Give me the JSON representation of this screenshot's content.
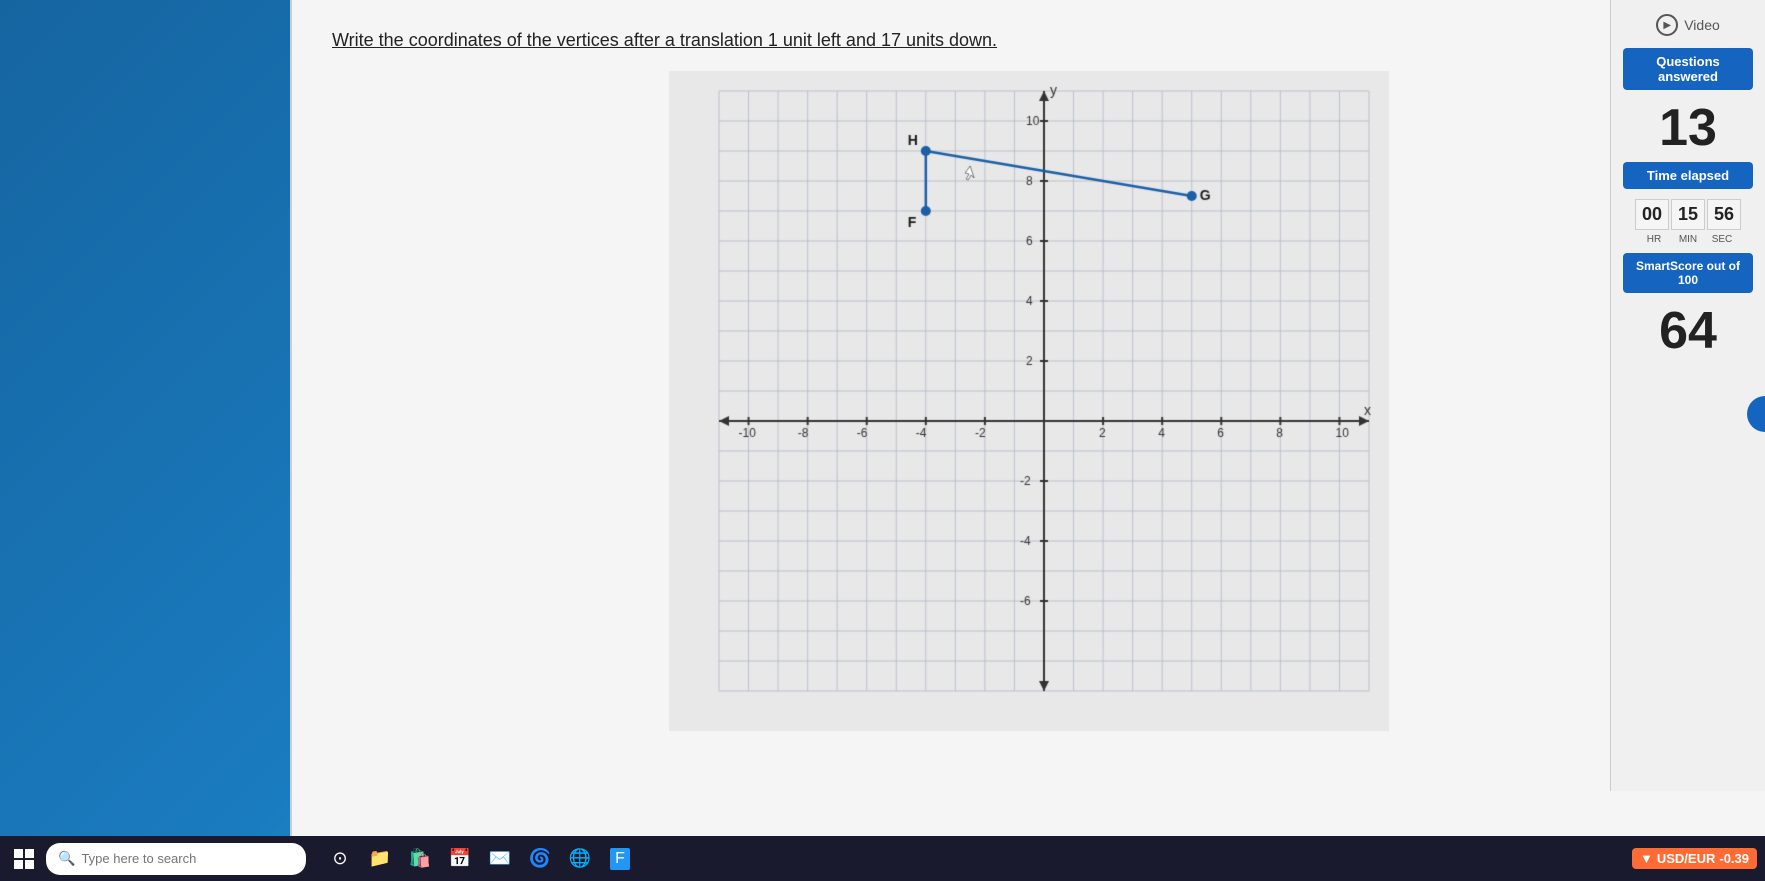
{
  "desktop": {
    "background_color": "#1a6fa8"
  },
  "question": {
    "text": "Write the coordinates of the vertices after a translation 1 unit left and 17 units down."
  },
  "graph": {
    "x_min": -10,
    "x_max": 10,
    "y_min": -8,
    "y_max": 10,
    "x_label": "x",
    "y_label": "y",
    "x_axis_ticks": [
      -10,
      -8,
      -6,
      -4,
      -2,
      2,
      4,
      6,
      8,
      10
    ],
    "y_axis_ticks": [
      -6,
      -4,
      -2,
      2,
      4,
      6,
      8,
      10
    ],
    "points": {
      "H": {
        "x": -4,
        "y": 9,
        "label": "H"
      },
      "F": {
        "x": -4,
        "y": 7,
        "label": "F"
      },
      "G": {
        "x": 5,
        "y": 7.5,
        "label": "G"
      }
    },
    "segments": [
      {
        "from": "H",
        "to": "G"
      },
      {
        "from": "H",
        "to": "F"
      }
    ]
  },
  "sidebar": {
    "video_label": "Video",
    "questions_answered_label": "Questions answered",
    "questions_count": "13",
    "time_elapsed_label": "Time elapsed",
    "time_hr": "00",
    "time_min": "15",
    "time_sec": "56",
    "hr_label": "HR",
    "min_label": "MIN",
    "sec_label": "SEC",
    "smartscore_label": "SmartScore out of 100",
    "smartscore_value": "64"
  },
  "taskbar": {
    "search_placeholder": "Type here to search",
    "currency_label": "USD/EUR",
    "currency_value": "-0.39"
  }
}
